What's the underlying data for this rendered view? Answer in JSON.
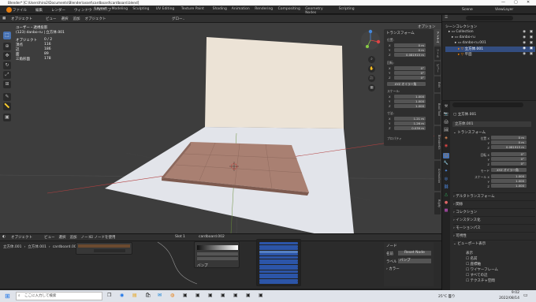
{
  "window": {
    "title": "Blender* [C:\\Users\\hiro2\\Documents\\Blender\\asset\\cardboard\\cardboard.blend]"
  },
  "menu": {
    "items": [
      "ファイル",
      "編集",
      "レンダー",
      "ウィンドウ",
      "ヘルプ"
    ],
    "workspaces": [
      "Layout",
      "Modeling",
      "Sculpting",
      "UV Editing",
      "Texture Paint",
      "Shading",
      "Animation",
      "Rendering",
      "Compositing",
      "Geometry Nodes",
      "Scripting"
    ],
    "active_workspace": "Layout",
    "scene": "Scene",
    "view_layer": "ViewLayer"
  },
  "viewport_header": {
    "mode": "オブジェクト",
    "items": [
      "ビュー",
      "選択",
      "追加",
      "オブジェクト"
    ],
    "orientation": "グロー..",
    "options": "オプション"
  },
  "overlay_info": {
    "view_name": "ユーザー・透視投影",
    "collection_line": "(123) danbo-ru | 立方体.001",
    "stats": [
      {
        "label": "オブジェクト",
        "value": "0 / 2"
      },
      {
        "label": "頂点",
        "value": "116"
      },
      {
        "label": "辺",
        "value": "186"
      },
      {
        "label": "面",
        "value": "89"
      },
      {
        "label": "三角形面",
        "value": "178"
      }
    ]
  },
  "n_panel": {
    "title": "トランスフォーム",
    "location_label": "位置:",
    "location": {
      "x": "0 m",
      "y": "0 m",
      "z": "0.081915 m"
    },
    "rotation_label": "回転:",
    "rotation": {
      "x": "0°",
      "y": "0°",
      "z": "0°"
    },
    "rotation_mode": "XYZ オイラー角",
    "scale_label": "スケール:",
    "scale": {
      "x": "1.000",
      "y": "1.000",
      "z": "1.000"
    },
    "dimensions_label": "寸法:",
    "dimensions": {
      "x": "1.21 m",
      "y": "1.26 m",
      "z": "0.039 m"
    },
    "properties_label": "プロパティ",
    "tabs": [
      "アイテム",
      "ツール",
      "ビュー",
      "Edit",
      "Bool Tool",
      "BlenderKit",
      "Animation",
      "Rigify"
    ]
  },
  "outliner": {
    "header": "シーンコレクション",
    "items": [
      "Collection",
      "danbo-ru",
      "danbo-ru.001",
      "立方体.001",
      "平面"
    ]
  },
  "properties": {
    "object_name": "立方体.001",
    "search_placeholder": "",
    "transform_title": "トランスフォーム",
    "location_label": "位置 X",
    "location": [
      "0 m",
      "0 m",
      "0.081915 m"
    ],
    "rotation_label": "回転 X",
    "rotation": [
      "0°",
      "0°",
      "0°"
    ],
    "mode_label": "モード",
    "mode": "XYZ オイラー角",
    "scale_label": "スケール X",
    "scale": [
      "1.000",
      "1.000",
      "1.000"
    ],
    "sections": [
      "デルタトランスフォーム",
      "関係",
      "コレクション",
      "インスタンス化",
      "モーションパス",
      "可視性",
      "ビューポート表示"
    ],
    "display_items": [
      "表示",
      "名前",
      "座標軸",
      "ワイヤーフレーム",
      "すべての辺",
      "テクスチャ空間"
    ]
  },
  "node_editor": {
    "mode": "オブジェクト",
    "items": [
      "ビュー",
      "選択",
      "追加",
      "ノード"
    ],
    "use_nodes": "ノードを使用",
    "slot": "Slot 1",
    "material": "cardboard.002",
    "breadcrumb": [
      "立方体.001",
      "立方体.001",
      "cardboard.002"
    ],
    "side_panel": {
      "title": "ノード",
      "name_label": "名前",
      "name_value": "Reset Node",
      "label_label": "ラベル",
      "bump": "バンプ",
      "color_label": "カラー"
    },
    "node_label": "バンプ",
    "node_menu_items": [
      "",
      "",
      "",
      "",
      "",
      "",
      "",
      "",
      "",
      "",
      "",
      "",
      "",
      "",
      ""
    ]
  },
  "taskbar": {
    "search_placeholder": "ここに入力して検索",
    "weather": "25°C 曇り",
    "time": "9:02",
    "date": "2022/08/14"
  }
}
